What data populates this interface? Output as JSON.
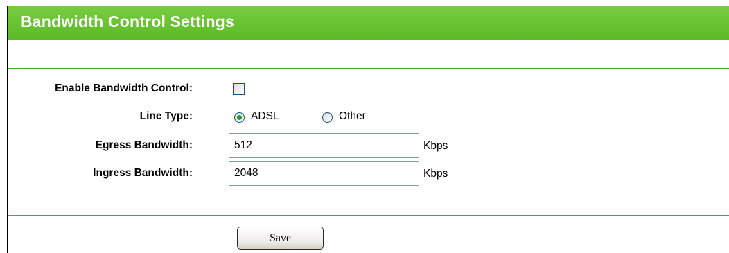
{
  "header": {
    "title": "Bandwidth Control Settings"
  },
  "form": {
    "enable": {
      "label": "Enable Bandwidth Control:",
      "checked": false
    },
    "line_type": {
      "label": "Line Type:",
      "options": [
        "ADSL",
        "Other"
      ],
      "selected": "ADSL"
    },
    "egress": {
      "label": "Egress Bandwidth:",
      "value": "512",
      "unit": "Kbps"
    },
    "ingress": {
      "label": "Ingress Bandwidth:",
      "value": "2048",
      "unit": "Kbps"
    }
  },
  "actions": {
    "save_label": "Save"
  },
  "colors": {
    "title_bar": "#6ac331",
    "divider": "#4fa82e",
    "radio_selected": "#21a121"
  }
}
